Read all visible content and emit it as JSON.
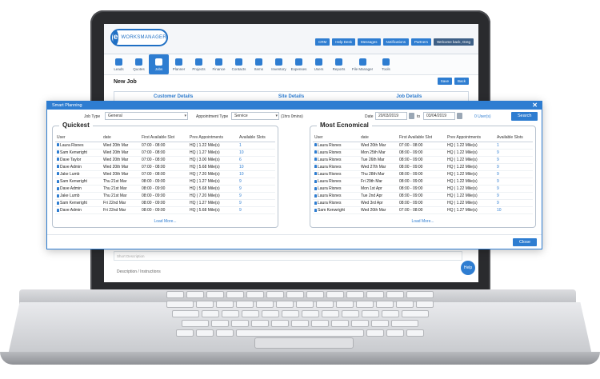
{
  "brand": {
    "name": "WORKSMANAGER"
  },
  "top_buttons": [
    "CRM",
    "Help Desk",
    "Messages",
    "Notifications",
    "Partners",
    "Welcome back, Greg"
  ],
  "nav": [
    "Leads",
    "Quotes",
    "Jobs",
    "Planner",
    "Projects",
    "Finance",
    "Contacts",
    "Items",
    "Inventory",
    "Expenses",
    "Users",
    "Reports",
    "File Manager",
    "Tools"
  ],
  "page": {
    "title": "New Job",
    "save": "Save",
    "back": "Back"
  },
  "tabs": [
    "Customer Details",
    "Site Details",
    "Job Details"
  ],
  "desc_placeholder": "Short Description",
  "bottom_label": "Description / Instructions",
  "help": "Help",
  "modal": {
    "title": "Smart Planning",
    "job_type_label": "Job Type",
    "job_type_value": "General",
    "appt_type_label": "Appointment Type",
    "appt_type_value": "Service",
    "appt_duration": "(1hrs 0mins)",
    "date_label": "Date",
    "date_from": "20/03/2019",
    "to_label": "to",
    "date_to": "03/04/2019",
    "users_link": "0 User(s)",
    "search": "Search",
    "close": "Close"
  },
  "columns": [
    "User",
    "date",
    "First Available Slot",
    "Prev Appointments",
    "Available Slots"
  ],
  "quickest": {
    "title": "Quickest",
    "load_more": "Load More...",
    "rows": [
      [
        "Laura Risnes",
        "Wed 20th Mar",
        "07:00 - 08:00",
        "HQ | 1.22 Mile(s)",
        "1"
      ],
      [
        "Sam Kenwright",
        "Wed 20th Mar",
        "07:00 - 08:00",
        "HQ | 1.27 Mile(s)",
        "10"
      ],
      [
        "Dave Taylor",
        "Wed 20th Mar",
        "07:00 - 08:00",
        "HQ | 3.00 Mile(s)",
        "6"
      ],
      [
        "Dave Admin",
        "Wed 20th Mar",
        "07:00 - 08:00",
        "HQ | 5.68 Mile(s)",
        "10"
      ],
      [
        "Jake Lumb",
        "Wed 20th Mar",
        "07:00 - 08:00",
        "HQ | 7.20 Mile(s)",
        "10"
      ],
      [
        "Sam Kenwright",
        "Thu 21st Mar",
        "08:00 - 09:00",
        "HQ | 1.27 Mile(s)",
        "9"
      ],
      [
        "Dave Admin",
        "Thu 21st Mar",
        "08:00 - 09:00",
        "HQ | 5.68 Mile(s)",
        "9"
      ],
      [
        "Jake Lumb",
        "Thu 21st Mar",
        "08:00 - 09:00",
        "HQ | 7.20 Mile(s)",
        "9"
      ],
      [
        "Sam Kenwright",
        "Fri 22nd Mar",
        "08:00 - 09:00",
        "HQ | 1.27 Mile(s)",
        "9"
      ],
      [
        "Dave Admin",
        "Fri 22nd Mar",
        "08:00 - 09:00",
        "HQ | 5.68 Mile(s)",
        "9"
      ]
    ]
  },
  "economical": {
    "title": "Most Ecnomical",
    "load_more": "Load More...",
    "rows": [
      [
        "Laura Risnes",
        "Wed 20th Mar",
        "07:00 - 08:00",
        "HQ | 1.22 Mile(s)",
        "1"
      ],
      [
        "Laura Risnes",
        "Mon 25th Mar",
        "08:00 - 09:00",
        "HQ | 1.22 Mile(s)",
        "9"
      ],
      [
        "Laura Risnes",
        "Tue 26th Mar",
        "08:00 - 09:00",
        "HQ | 1.22 Mile(s)",
        "9"
      ],
      [
        "Laura Risnes",
        "Wed 27th Mar",
        "08:00 - 09:00",
        "HQ | 1.22 Mile(s)",
        "9"
      ],
      [
        "Laura Risnes",
        "Thu 28th Mar",
        "08:00 - 09:00",
        "HQ | 1.22 Mile(s)",
        "9"
      ],
      [
        "Laura Risnes",
        "Fri 29th Mar",
        "08:00 - 09:00",
        "HQ | 1.22 Mile(s)",
        "9"
      ],
      [
        "Laura Risnes",
        "Mon 1st Apr",
        "08:00 - 09:00",
        "HQ | 1.22 Mile(s)",
        "9"
      ],
      [
        "Laura Risnes",
        "Tue 2nd Apr",
        "08:00 - 09:00",
        "HQ | 1.22 Mile(s)",
        "9"
      ],
      [
        "Laura Risnes",
        "Wed 3rd Apr",
        "08:00 - 09:00",
        "HQ | 1.22 Mile(s)",
        "9"
      ],
      [
        "Sam Kenwright",
        "Wed 20th Mar",
        "07:00 - 08:00",
        "HQ | 1.27 Mile(s)",
        "10"
      ]
    ]
  }
}
